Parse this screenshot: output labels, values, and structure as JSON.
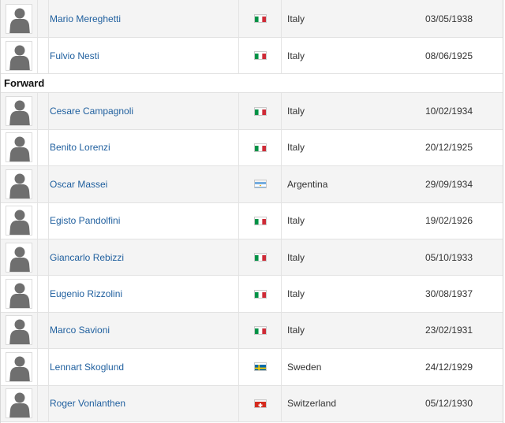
{
  "sections": [
    {
      "heading": "",
      "players": [
        {
          "name": "Mario Mereghetti",
          "flag": "italy-flag",
          "nation": "Italy",
          "dob": "03/05/1938"
        },
        {
          "name": "Fulvio Nesti",
          "flag": "italy-flag",
          "nation": "Italy",
          "dob": "08/06/1925"
        }
      ]
    },
    {
      "heading": "Forward",
      "players": [
        {
          "name": "Cesare Campagnoli",
          "flag": "italy-flag",
          "nation": "Italy",
          "dob": "10/02/1934"
        },
        {
          "name": "Benito Lorenzi",
          "flag": "italy-flag",
          "nation": "Italy",
          "dob": "20/12/1925"
        },
        {
          "name": "Oscar Massei",
          "flag": "argentina-flag",
          "nation": "Argentina",
          "dob": "29/09/1934"
        },
        {
          "name": "Egisto Pandolfini",
          "flag": "italy-flag",
          "nation": "Italy",
          "dob": "19/02/1926"
        },
        {
          "name": "Giancarlo Rebizzi",
          "flag": "italy-flag",
          "nation": "Italy",
          "dob": "05/10/1933"
        },
        {
          "name": "Eugenio Rizzolini",
          "flag": "italy-flag",
          "nation": "Italy",
          "dob": "30/08/1937"
        },
        {
          "name": "Marco Savioni",
          "flag": "italy-flag",
          "nation": "Italy",
          "dob": "23/02/1931"
        },
        {
          "name": "Lennart Skoglund",
          "flag": "sweden-flag",
          "nation": "Sweden",
          "dob": "24/12/1929"
        },
        {
          "name": "Roger Vonlanthen",
          "flag": "switzerland-flag",
          "nation": "Switzerland",
          "dob": "05/12/1930"
        }
      ]
    }
  ],
  "colors": {
    "link": "#1f5f9e",
    "row_alt": "#f4f4f4",
    "italy": [
      "#009246",
      "#ffffff",
      "#ce2b37"
    ],
    "argentina": [
      "#74acdf",
      "#ffffff",
      "#f6b40e"
    ],
    "sweden": [
      "#006aa7",
      "#fecc00"
    ],
    "switzerland": [
      "#d52b1e",
      "#ffffff"
    ]
  }
}
